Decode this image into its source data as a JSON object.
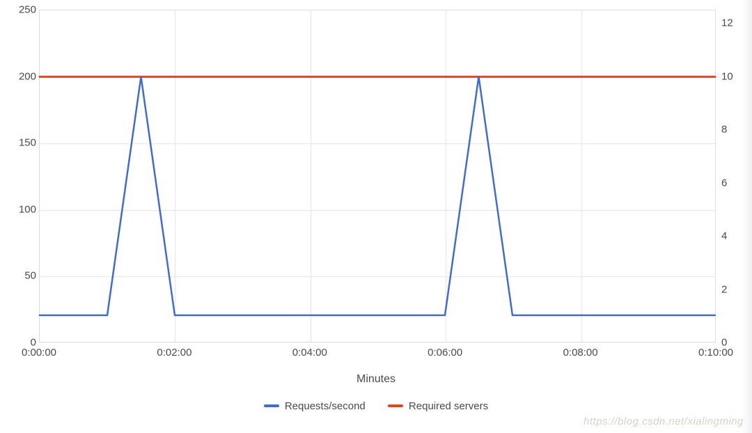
{
  "chart_data": {
    "type": "line",
    "xlabel": "Minutes",
    "x_ticks": [
      "0:00:00",
      "0:02:00",
      "0:04:00",
      "0:06:00",
      "0:08:00",
      "0:10:00"
    ],
    "x_minutes": [
      0,
      1,
      2,
      3,
      4,
      5,
      6,
      7,
      8,
      9,
      10
    ],
    "y_left": {
      "label": "",
      "min": 0,
      "max": 250,
      "ticks": [
        0,
        50,
        100,
        150,
        200,
        250
      ]
    },
    "y_right": {
      "label": "",
      "min": 0,
      "max": 12.5,
      "ticks": [
        0,
        2,
        4,
        6,
        8,
        10,
        12
      ]
    },
    "series": [
      {
        "name": "Requests/second",
        "color": "#3f6bd4",
        "axis": "left",
        "x": [
          0,
          1,
          1.5,
          2,
          3,
          4,
          5,
          6,
          6.5,
          7,
          8,
          9,
          10
        ],
        "values": [
          20,
          20,
          200,
          20,
          20,
          20,
          20,
          20,
          200,
          20,
          20,
          20,
          20
        ]
      },
      {
        "name": "Required servers",
        "color": "#d9481f",
        "axis": "right",
        "x": [
          0,
          10
        ],
        "values": [
          10,
          10
        ]
      }
    ],
    "legend": [
      "Requests/second",
      "Required servers"
    ]
  },
  "watermark": "https://blog.csdn.net/xialingming"
}
